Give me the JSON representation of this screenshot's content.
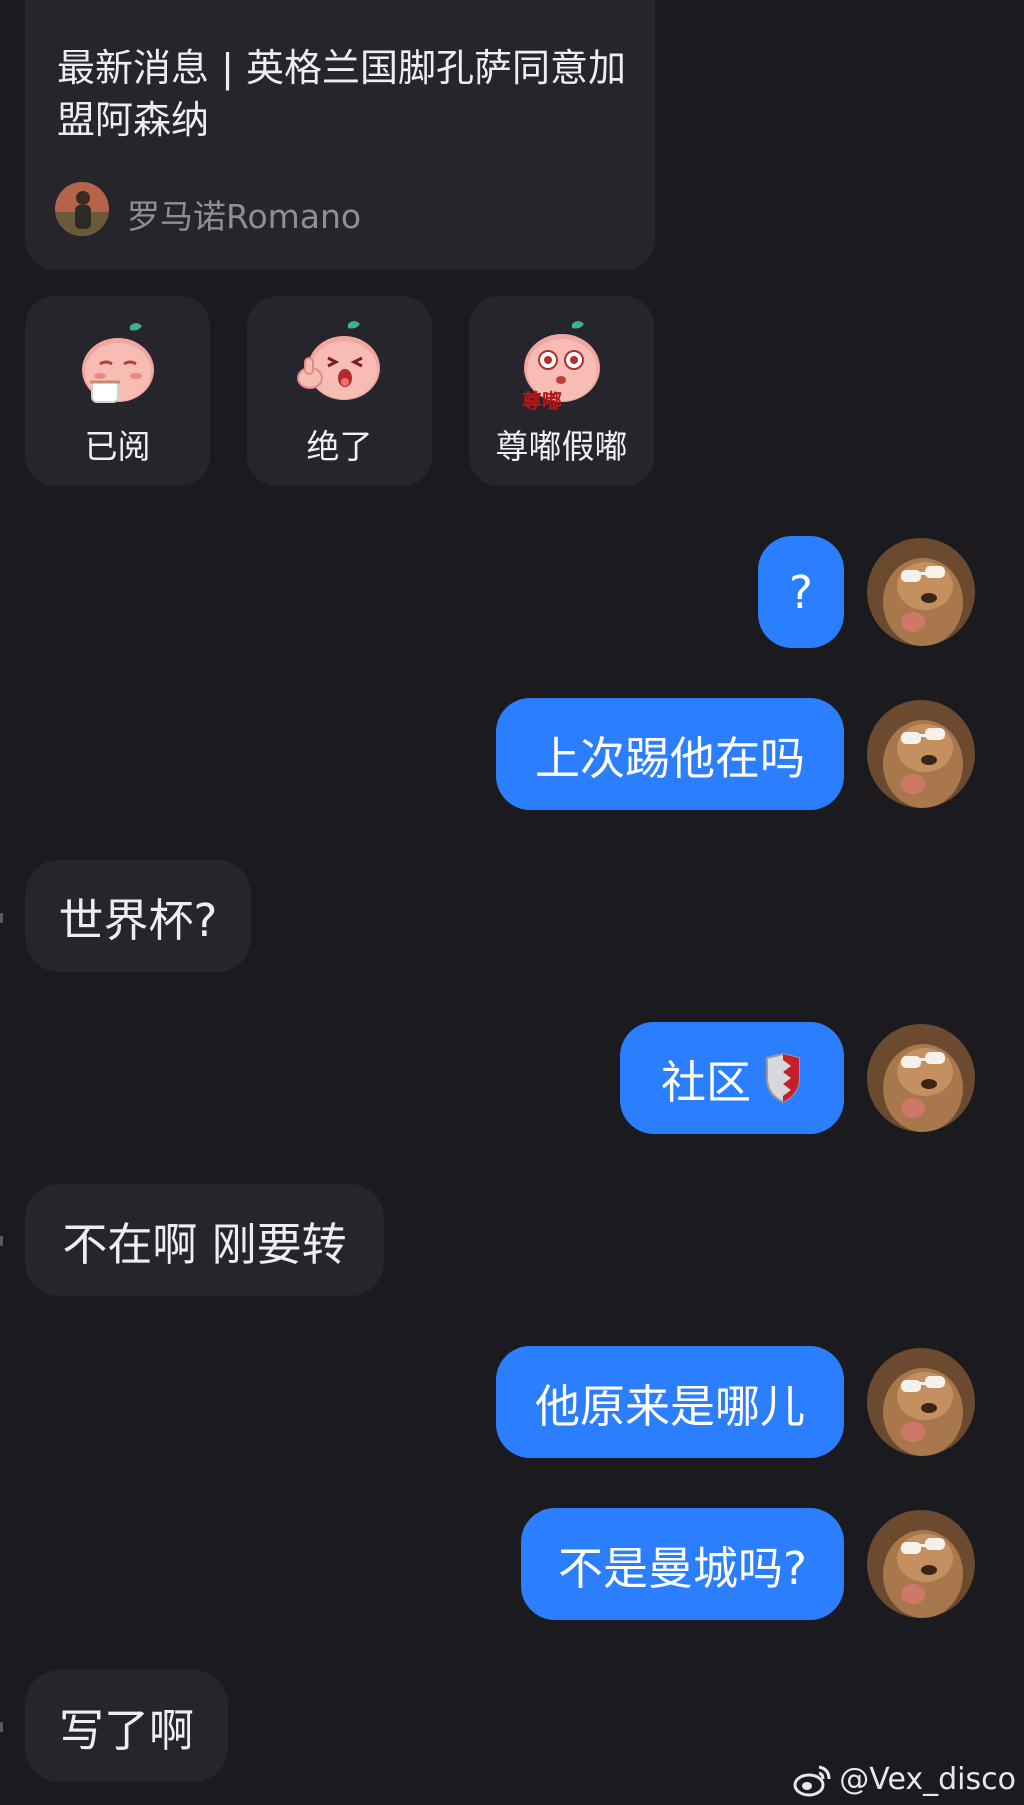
{
  "news_card": {
    "title": "最新消息 | 英格兰国脚孔萨同意加盟阿森纳",
    "author": "罗马诺Romano"
  },
  "reactions": [
    {
      "label": "已阅",
      "icon": "peach-drinking-tea-icon"
    },
    {
      "label": "绝了",
      "icon": "peach-thumbs-up-icon"
    },
    {
      "label": "尊嘟假嘟",
      "icon": "peach-shocked-icon",
      "sticker_text": "尊嘟"
    }
  ],
  "messages": [
    {
      "side": "out",
      "text": "?"
    },
    {
      "side": "out",
      "text": "上次踢他在吗"
    },
    {
      "side": "in",
      "text": "世界杯?"
    },
    {
      "side": "out",
      "text": "社区",
      "icon": "shield-badge-icon"
    },
    {
      "side": "in",
      "text": "不在啊 刚要转"
    },
    {
      "side": "out",
      "text": "他原来是哪儿"
    },
    {
      "side": "out",
      "text": "不是曼城吗?"
    },
    {
      "side": "in",
      "text": "写了啊"
    }
  ],
  "self_avatar_icon": "dog-with-sunglasses-avatar",
  "watermark": {
    "icon": "weibo-icon",
    "text": "@Vex_disco"
  },
  "colors": {
    "background": "#1a1a1f",
    "incoming_bubble": "#25252b",
    "outgoing_bubble": "#2b7fff",
    "secondary_text": "#8e8e96"
  }
}
